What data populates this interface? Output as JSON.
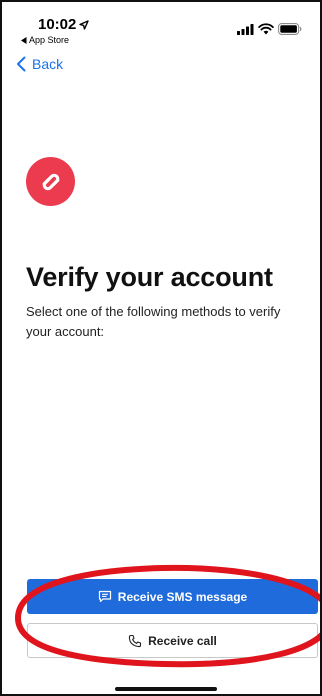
{
  "status_bar": {
    "time": "10:02",
    "back_app_label": "App Store"
  },
  "nav": {
    "back_label": "Back"
  },
  "content": {
    "title": "Verify your account",
    "subtitle": "Select one of the following methods to verify your account:"
  },
  "actions": {
    "sms_label": "Receive SMS message",
    "call_label": "Receive call"
  },
  "colors": {
    "primary": "#1f6bdc",
    "link": "#1a73e8",
    "logo": "#ec3b4e",
    "annotation": "#e0141c"
  },
  "icons": {
    "location": "location-arrow-icon",
    "back_app": "triangle-left-icon",
    "signal": "signal-icon",
    "wifi": "wifi-icon",
    "battery": "battery-icon",
    "back": "chevron-left-icon",
    "logo": "authy-logo-icon",
    "sms": "message-icon",
    "call": "phone-icon"
  }
}
